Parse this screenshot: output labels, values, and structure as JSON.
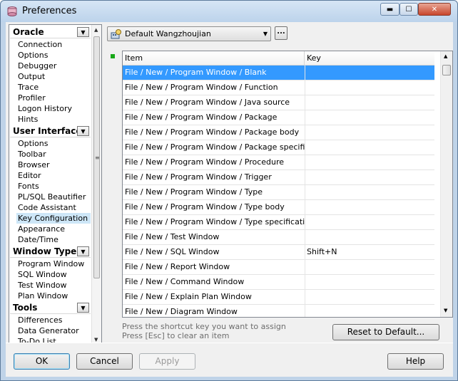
{
  "window": {
    "title": "Preferences",
    "min_label": "▬",
    "max_label": "☐",
    "close_label": "✕"
  },
  "nav": {
    "groups": [
      {
        "label": "Oracle",
        "items": [
          "Connection",
          "Options",
          "Debugger",
          "Output",
          "Trace",
          "Profiler",
          "Logon History",
          "Hints"
        ]
      },
      {
        "label": "User Interface",
        "items": [
          "Options",
          "Toolbar",
          "Browser",
          "Editor",
          "Fonts",
          "PL/SQL Beautifier",
          "Code Assistant",
          "Key Configuration",
          "Appearance",
          "Date/Time"
        ]
      },
      {
        "label": "Window Types",
        "items": [
          "Program Window",
          "SQL Window",
          "Test Window",
          "Plan Window"
        ]
      },
      {
        "label": "Tools",
        "items": [
          "Differences",
          "Data Generator",
          "To-Do List"
        ]
      }
    ],
    "selected_item": "Key Configuration"
  },
  "profile": {
    "selected": "Default Wangzhoujian",
    "more_label": "..."
  },
  "grid": {
    "headers": [
      "Item",
      "Key"
    ],
    "rows": [
      {
        "item": "File / New / Program Window / Blank",
        "key": ""
      },
      {
        "item": "File / New / Program Window / Function",
        "key": ""
      },
      {
        "item": "File / New / Program Window / Java source",
        "key": ""
      },
      {
        "item": "File / New / Program Window / Package",
        "key": ""
      },
      {
        "item": "File / New / Program Window / Package body",
        "key": ""
      },
      {
        "item": "File / New / Program Window / Package specification",
        "key": ""
      },
      {
        "item": "File / New / Program Window / Procedure",
        "key": ""
      },
      {
        "item": "File / New / Program Window / Trigger",
        "key": ""
      },
      {
        "item": "File / New / Program Window / Type",
        "key": ""
      },
      {
        "item": "File / New / Program Window / Type body",
        "key": ""
      },
      {
        "item": "File / New / Program Window / Type specification",
        "key": ""
      },
      {
        "item": "File / New / Test Window",
        "key": ""
      },
      {
        "item": "File / New / SQL Window",
        "key": "Shift+N"
      },
      {
        "item": "File / New / Report Window",
        "key": ""
      },
      {
        "item": "File / New / Command Window",
        "key": ""
      },
      {
        "item": "File / New / Explain Plan Window",
        "key": ""
      },
      {
        "item": "File / New / Diagram Window",
        "key": ""
      }
    ]
  },
  "hints": [
    "Press the shortcut key you want to assign",
    "Press [Esc] to clear an item"
  ],
  "buttons": {
    "reset": "Reset to Default...",
    "ok": "OK",
    "cancel": "Cancel",
    "apply": "Apply",
    "help": "Help"
  }
}
